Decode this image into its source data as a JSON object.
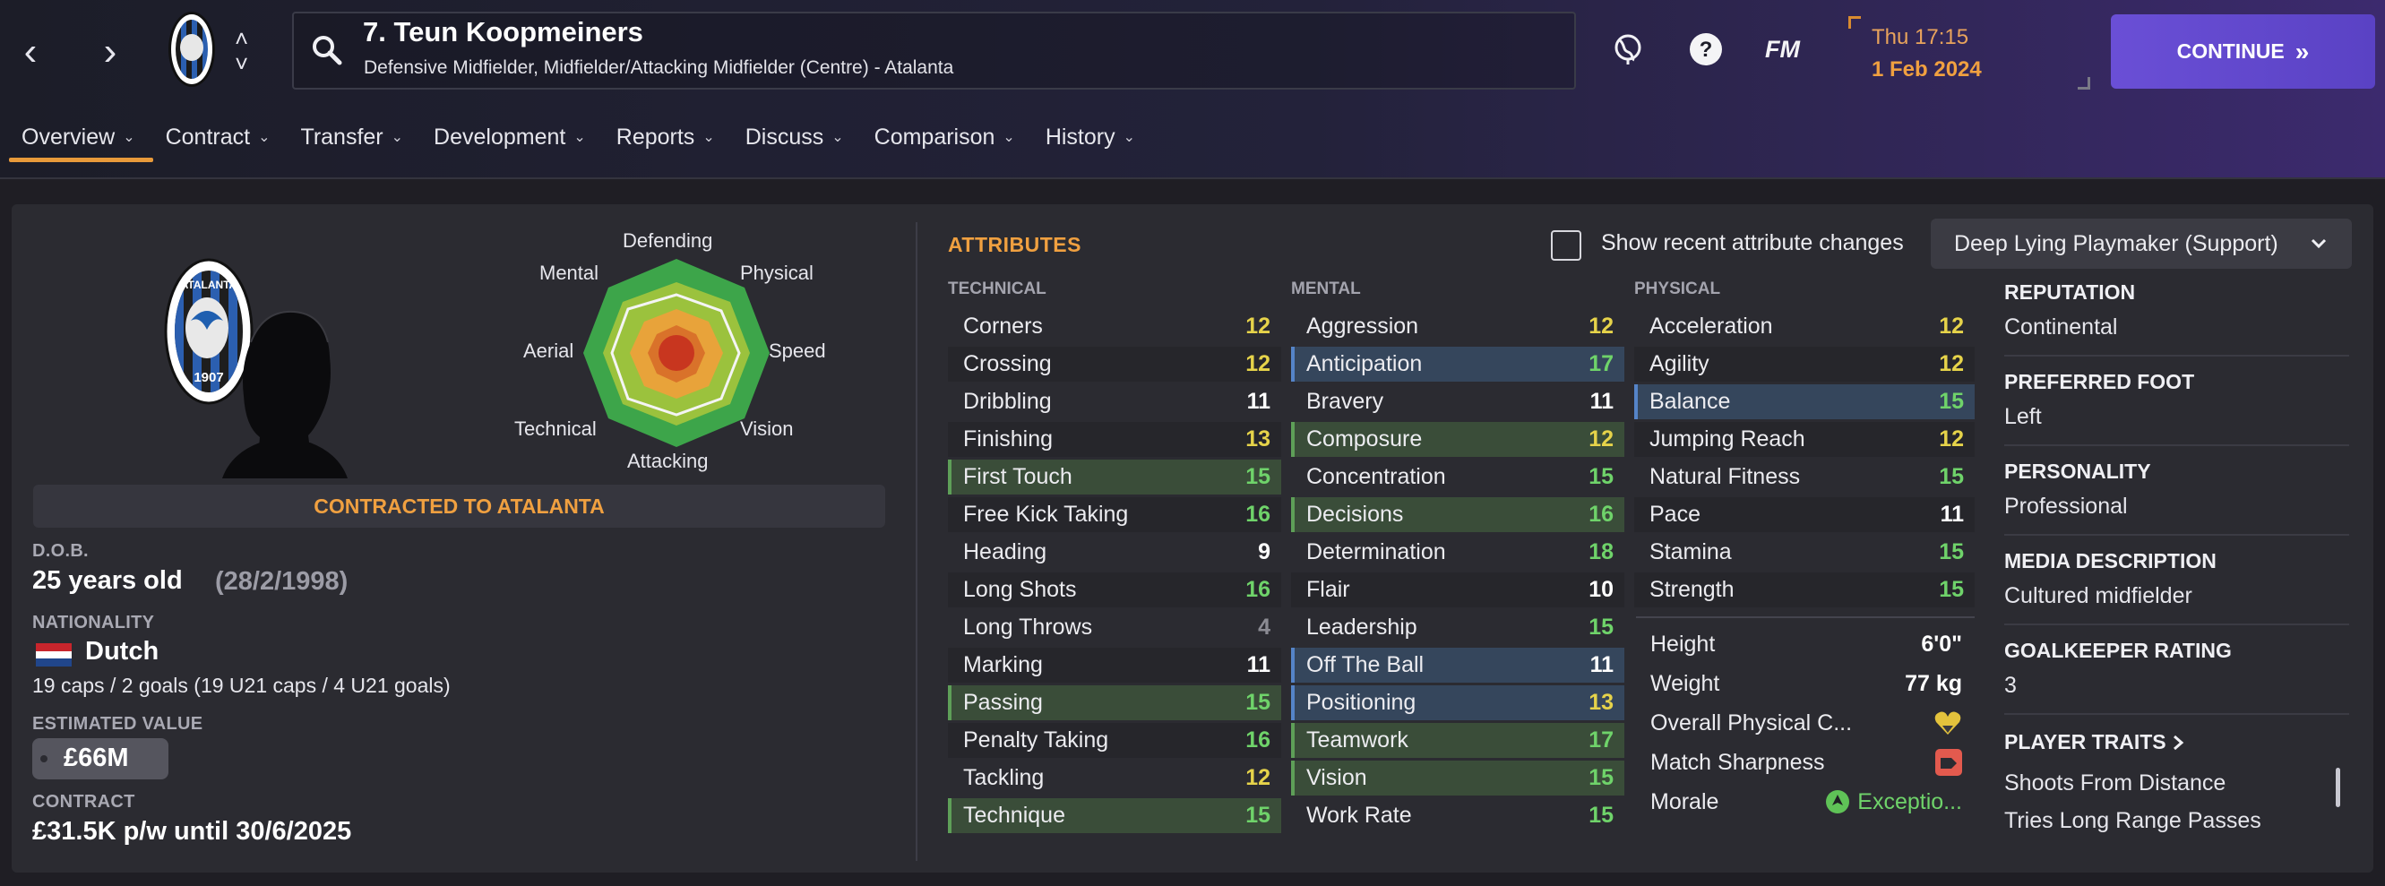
{
  "header": {
    "player_name": "7. Teun Koopmeiners",
    "player_subtitle": "Defensive Midfielder, Midfielder/Attacking Midfielder (Centre) - Atalanta",
    "time": "Thu 17:15",
    "date": "1 Feb 2024",
    "continue_label": "CONTINUE",
    "fm_label": "FM"
  },
  "tabs": [
    {
      "label": "Overview"
    },
    {
      "label": "Contract"
    },
    {
      "label": "Transfer"
    },
    {
      "label": "Development"
    },
    {
      "label": "Reports"
    },
    {
      "label": "Discuss"
    },
    {
      "label": "Comparison"
    },
    {
      "label": "History"
    }
  ],
  "crest_text": {
    "top": "ATALANTA",
    "year": "1907"
  },
  "radar": {
    "labels": {
      "defending": "Defending",
      "physical": "Physical",
      "speed": "Speed",
      "vision": "Vision",
      "attacking": "Attacking",
      "technical": "Technical",
      "aerial": "Aerial",
      "mental": "Mental"
    },
    "colors": {
      "outer": "#3da54a",
      "mid": "#9bc23d",
      "inner": "#e8a33a",
      "core": "#c8361f"
    }
  },
  "profile": {
    "contracted_label": "CONTRACTED TO ATALANTA",
    "dob_label": "D.O.B.",
    "age": "25 years old",
    "dob": "(28/2/1998)",
    "nationality_label": "NATIONALITY",
    "nationality": "Dutch",
    "caps": "19 caps / 2 goals (19 U21 caps / 4 U21 goals)",
    "value_label": "ESTIMATED VALUE",
    "value": "£66M",
    "contract_label": "CONTRACT",
    "contract": "£31.5K p/w until 30/6/2025"
  },
  "attributes": {
    "title": "ATTRIBUTES",
    "show_changes_label": "Show recent attribute changes",
    "role": "Deep Lying Playmaker (Support)",
    "technical_label": "TECHNICAL",
    "mental_label": "MENTAL",
    "physical_label": "PHYSICAL",
    "technical": [
      {
        "name": "Corners",
        "value": "12"
      },
      {
        "name": "Crossing",
        "value": "12"
      },
      {
        "name": "Dribbling",
        "value": "11"
      },
      {
        "name": "Finishing",
        "value": "13"
      },
      {
        "name": "First Touch",
        "value": "15"
      },
      {
        "name": "Free Kick Taking",
        "value": "16"
      },
      {
        "name": "Heading",
        "value": "9"
      },
      {
        "name": "Long Shots",
        "value": "16"
      },
      {
        "name": "Long Throws",
        "value": "4"
      },
      {
        "name": "Marking",
        "value": "11"
      },
      {
        "name": "Passing",
        "value": "15"
      },
      {
        "name": "Penalty Taking",
        "value": "16"
      },
      {
        "name": "Tackling",
        "value": "12"
      },
      {
        "name": "Technique",
        "value": "15"
      }
    ],
    "mental": [
      {
        "name": "Aggression",
        "value": "12"
      },
      {
        "name": "Anticipation",
        "value": "17"
      },
      {
        "name": "Bravery",
        "value": "11"
      },
      {
        "name": "Composure",
        "value": "12"
      },
      {
        "name": "Concentration",
        "value": "15"
      },
      {
        "name": "Decisions",
        "value": "16"
      },
      {
        "name": "Determination",
        "value": "18"
      },
      {
        "name": "Flair",
        "value": "10"
      },
      {
        "name": "Leadership",
        "value": "15"
      },
      {
        "name": "Off The Ball",
        "value": "11"
      },
      {
        "name": "Positioning",
        "value": "13"
      },
      {
        "name": "Teamwork",
        "value": "17"
      },
      {
        "name": "Vision",
        "value": "15"
      },
      {
        "name": "Work Rate",
        "value": "15"
      }
    ],
    "physical": [
      {
        "name": "Acceleration",
        "value": "12"
      },
      {
        "name": "Agility",
        "value": "12"
      },
      {
        "name": "Balance",
        "value": "15"
      },
      {
        "name": "Jumping Reach",
        "value": "12"
      },
      {
        "name": "Natural Fitness",
        "value": "15"
      },
      {
        "name": "Pace",
        "value": "11"
      },
      {
        "name": "Stamina",
        "value": "15"
      },
      {
        "name": "Strength",
        "value": "15"
      }
    ],
    "stats": {
      "height_label": "Height",
      "height": "6'0\"",
      "weight_label": "Weight",
      "weight": "77 kg",
      "condition_label": "Overall Physical C...",
      "sharpness_label": "Match Sharpness",
      "morale_label": "Morale",
      "morale": "Exceptio..."
    }
  },
  "info": {
    "reputation_label": "REPUTATION",
    "reputation": "Continental",
    "foot_label": "PREFERRED FOOT",
    "foot": "Left",
    "personality_label": "PERSONALITY",
    "personality": "Professional",
    "media_label": "MEDIA DESCRIPTION",
    "media": "Cultured midfielder",
    "gk_label": "GOALKEEPER RATING",
    "gk": "3",
    "traits_label": "PLAYER TRAITS",
    "traits": [
      "Shoots From Distance",
      "Tries Long Range Passes"
    ]
  }
}
